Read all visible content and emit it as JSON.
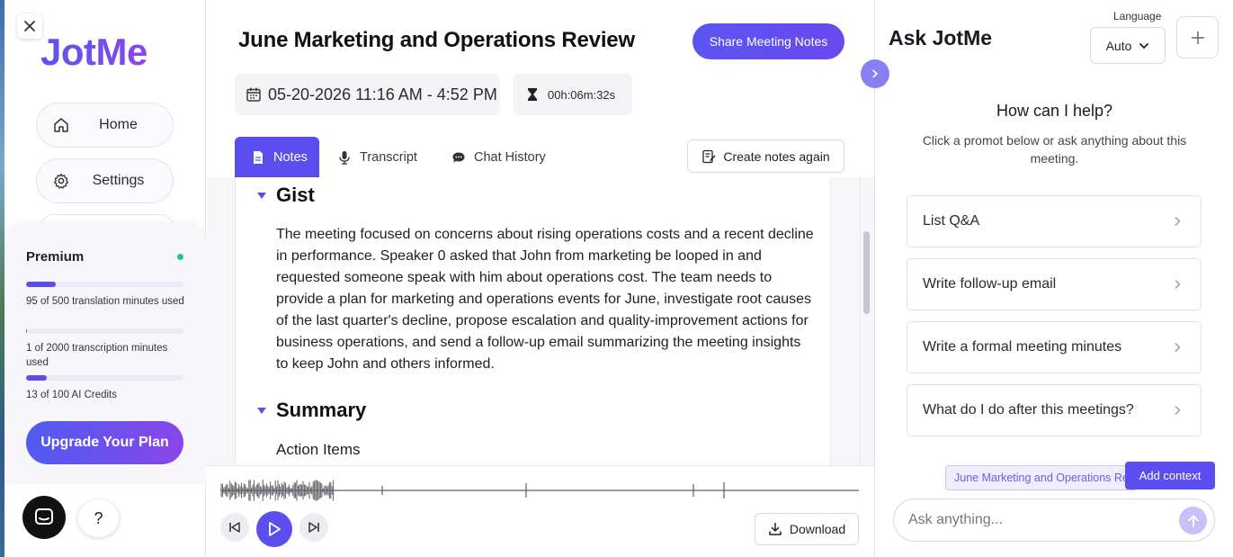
{
  "sidebar": {
    "logo": "JotMe",
    "nav": [
      {
        "label": "Home",
        "icon": "home-icon"
      },
      {
        "label": "Settings",
        "icon": "gear-icon"
      }
    ],
    "premium": {
      "title": "Premium",
      "status_color": "#2bbf8a",
      "usage": [
        {
          "text": "95 of 500 translation minutes used",
          "fraction": 0.19
        },
        {
          "text": "1 of 2000 transcription minutes used",
          "fraction": 0.0005
        },
        {
          "text": "13 of 100 AI Credits",
          "fraction": 0.13
        }
      ],
      "upgrade_label": "Upgrade Your Plan"
    },
    "help_label": "?"
  },
  "meeting": {
    "title": "June Marketing and Operations Review",
    "share_label": "Share Meeting Notes",
    "datetime": "05-20-2026 11:16 AM - 4:52 PM",
    "duration": "00h:06m:32s"
  },
  "tabs": [
    {
      "label": "Notes",
      "icon": "document-icon",
      "active": true
    },
    {
      "label": "Transcript",
      "icon": "microphone-icon",
      "active": false
    },
    {
      "label": "Chat History",
      "icon": "chat-bubble-icon",
      "active": false
    }
  ],
  "create_notes_label": "Create notes again",
  "notes": {
    "gist_title": "Gist",
    "gist_text": "The meeting focused on concerns about rising operations costs and a recent decline in performance. Speaker 0 asked that John from marketing be looped in and requested someone speak with him about operations cost. The team needs to provide a plan for marketing and operations events for June, investigate root causes of the last quarter's decline, propose escalation and quality-improvement actions for business operations, and send a follow-up email summarizing the meeting insights to keep John and others informed.",
    "summary_title": "Summary",
    "action_items_label": "Action Items"
  },
  "player": {
    "download_label": "Download"
  },
  "ask": {
    "title": "Ask JotMe",
    "language_label": "Language",
    "language_value": "Auto",
    "help_title": "How can I help?",
    "help_sub": "Click a promot below or ask anything about this meeting.",
    "prompts": [
      "List Q&A",
      "Write follow-up email",
      "Write a formal meeting minutes",
      "What do I do after this meetings?"
    ],
    "context_chip": "June Marketing and Operations Review",
    "add_context_label": "Add context",
    "input_placeholder": "Ask anything..."
  },
  "colors": {
    "accent": "#5a4ef0",
    "brand_gradient_start": "#5a55ee",
    "brand_gradient_end": "#8a46ea"
  }
}
